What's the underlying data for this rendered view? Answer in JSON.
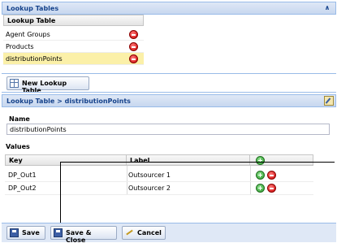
{
  "lookup_tables_panel": {
    "title": "Lookup Tables",
    "column_header": "Lookup Table",
    "rows": [
      {
        "name": "Agent Groups",
        "selected": false
      },
      {
        "name": "Products",
        "selected": false
      },
      {
        "name": "distributionPoints",
        "selected": true
      }
    ],
    "new_button_label": "New Lookup Table"
  },
  "editor": {
    "breadcrumb": "Lookup Table > distributionPoints",
    "name_label": "Name",
    "name_value": "distributionPoints",
    "values_label": "Values",
    "columns": {
      "key": "Key",
      "label": "Label"
    },
    "rows": [
      {
        "key": "DP_Out1",
        "label": "Outsourcer 1"
      },
      {
        "key": "DP_Out2",
        "label": "Outsourcer 2"
      }
    ]
  },
  "footer_buttons": {
    "save": "Save",
    "save_close": "Save & Close",
    "cancel": "Cancel"
  },
  "icons": {
    "delete": "delete-icon",
    "add": "add-icon",
    "collapse": "double-chevron-up-icon",
    "edit": "edit-icon"
  },
  "colors": {
    "header_text": "#15428b",
    "header_border": "#99bbe8",
    "selected_row": "#fbf0a8"
  }
}
